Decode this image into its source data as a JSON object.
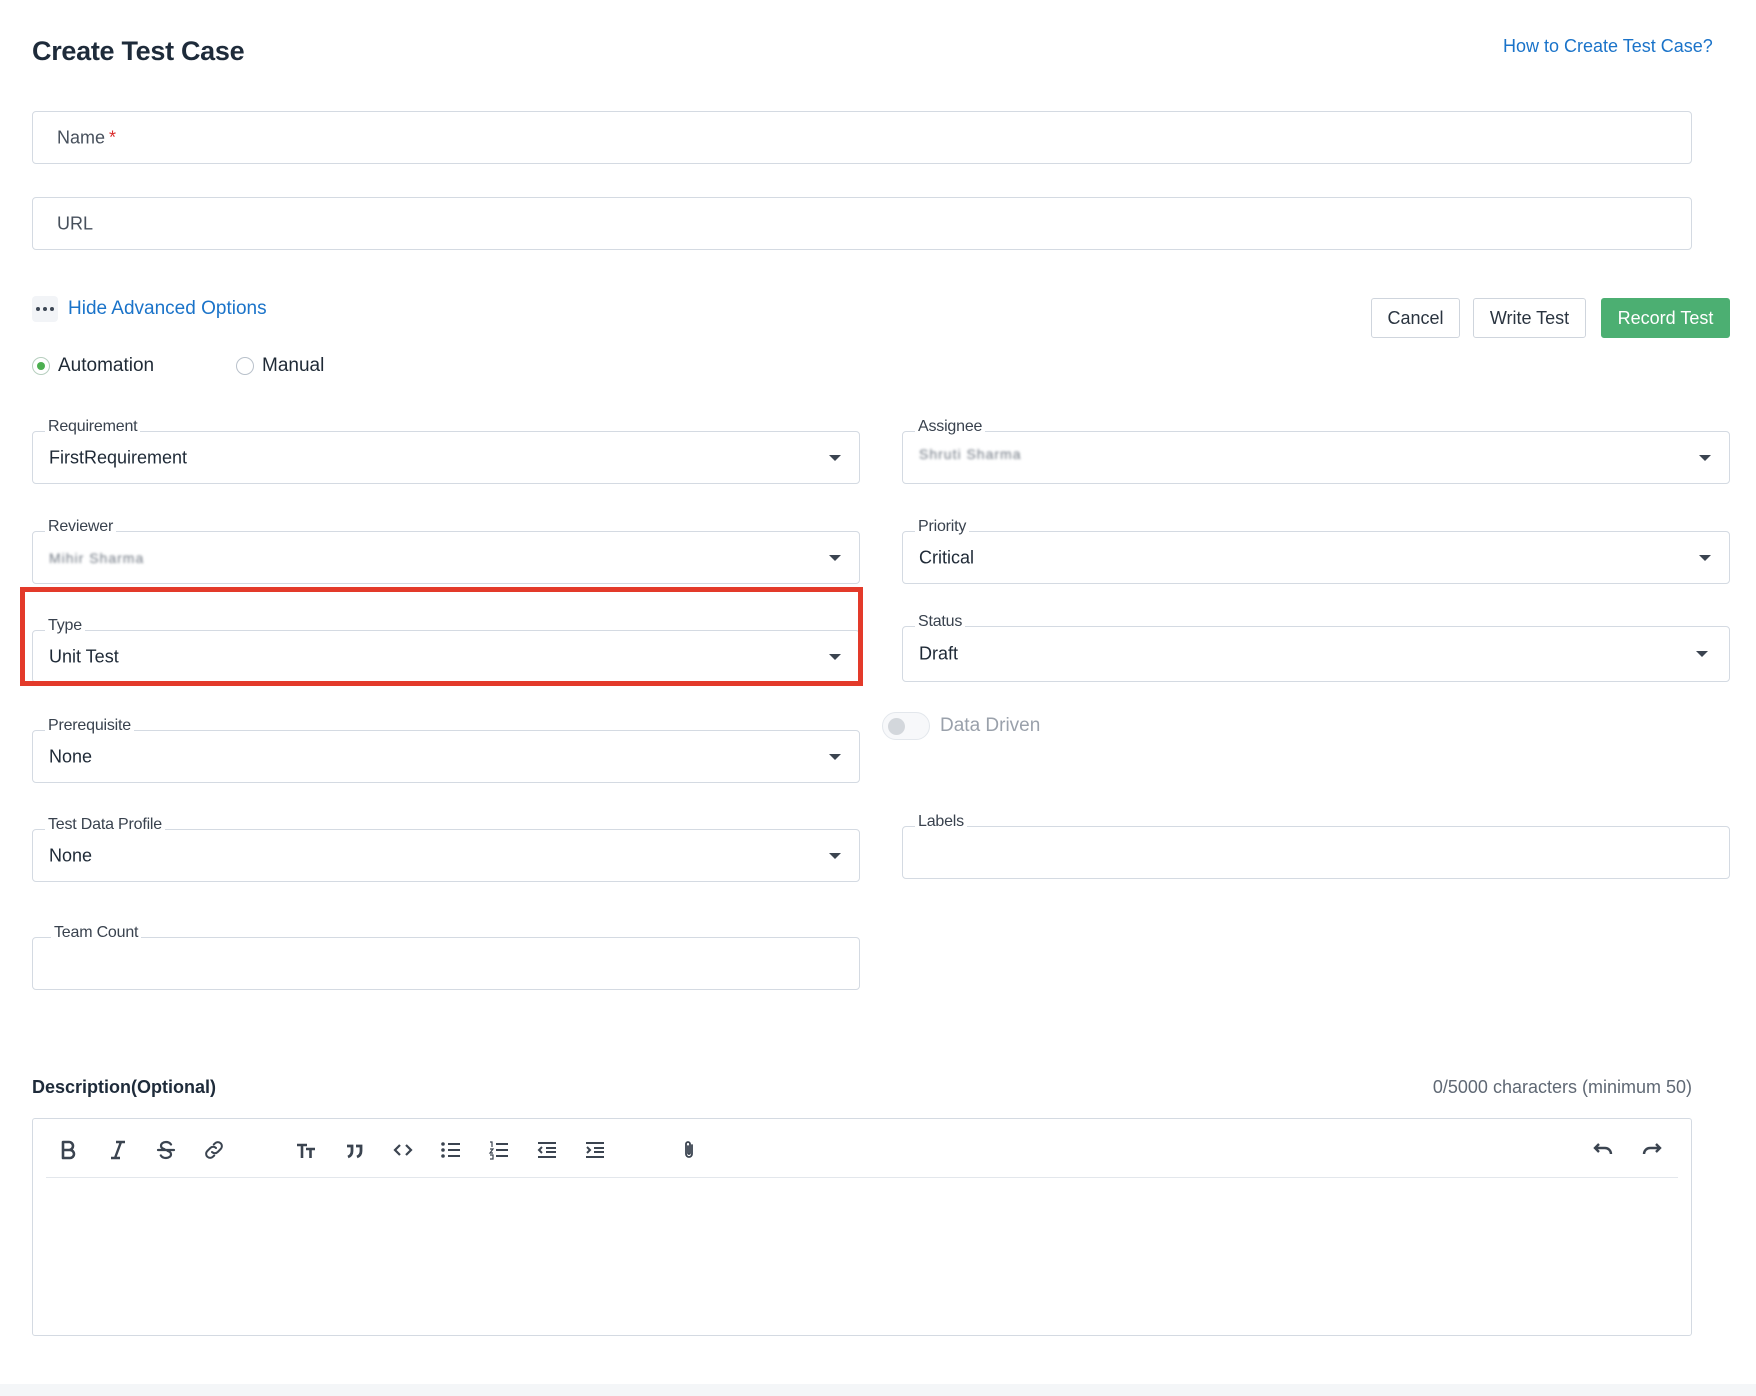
{
  "page": {
    "title": "Create Test Case",
    "help_link": "How to Create Test Case?"
  },
  "form": {
    "name_placeholder": "Name",
    "name_required_mark": "*",
    "url_placeholder": "URL",
    "advanced_toggle": "Hide Advanced Options"
  },
  "actions": {
    "cancel": "Cancel",
    "write_test": "Write Test",
    "record_test": "Record Test",
    "primary_color": "#4caf72"
  },
  "test_mode": {
    "options": [
      "Automation",
      "Manual"
    ],
    "selected": "Automation"
  },
  "fields": {
    "requirement": {
      "label": "Requirement",
      "value": "FirstRequirement"
    },
    "assignee": {
      "label": "Assignee",
      "value": "Shruti Sharma",
      "obscured": true
    },
    "reviewer": {
      "label": "Reviewer",
      "value": "Mihir Sharma",
      "obscured": true
    },
    "priority": {
      "label": "Priority",
      "value": "Critical"
    },
    "type": {
      "label": "Type",
      "value": "Unit Test",
      "highlighted": true
    },
    "status": {
      "label": "Status",
      "value": "Draft"
    },
    "prerequisite": {
      "label": "Prerequisite",
      "value": "None"
    },
    "data_driven": {
      "label": "Data Driven",
      "enabled": false
    },
    "test_data_profile": {
      "label": "Test Data Profile",
      "value": "None"
    },
    "labels": {
      "label": "Labels",
      "value": ""
    },
    "team_count": {
      "label": "Team Count",
      "value": ""
    }
  },
  "description": {
    "label": "Description(Optional)",
    "char_count": "0/5000 characters (minimum 50)",
    "toolbar": [
      "bold-icon",
      "italic-icon",
      "strikethrough-icon",
      "link-icon",
      "heading-icon",
      "quote-icon",
      "code-icon",
      "bullet-list-icon",
      "numbered-list-icon",
      "outdent-icon",
      "indent-icon",
      "attachment-icon",
      "undo-icon",
      "redo-icon"
    ]
  },
  "highlight_color": "#e33a2a"
}
